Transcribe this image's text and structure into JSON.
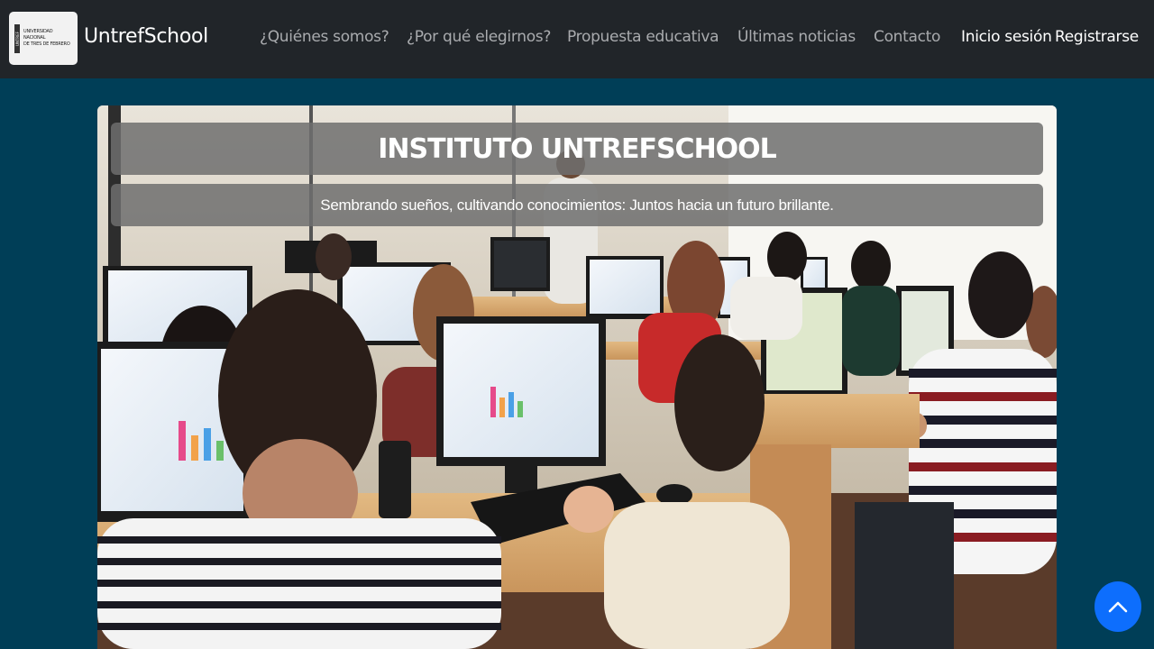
{
  "brand": {
    "logo_lines": [
      "UNIVERSIDAD",
      "NACIONAL",
      "DE TRES DE FEBRERO"
    ],
    "logo_vertical": "UNTREF",
    "name": "UntrefSchool"
  },
  "nav": {
    "items": [
      {
        "label": "¿Quiénes somos?"
      },
      {
        "label": "¿Por qué elegirnos?"
      },
      {
        "label": "Propuesta educativa"
      },
      {
        "label": "Últimas noticias"
      },
      {
        "label": "Contacto"
      }
    ],
    "login": "Inicio sesión",
    "register": "Registrarse"
  },
  "hero": {
    "title": "INSTITUTO UNTREFSCHOOL",
    "subtitle": "Sembrando sueños, cultivando conocimientos: Juntos hacia un futuro brillante.",
    "image_alt": "Students working at computers in a classroom"
  },
  "scroll_top": {
    "icon": "chevron-up-icon"
  },
  "colors": {
    "navbar_bg": "#212529",
    "page_bg": "#003e57",
    "accent": "#0d6efd"
  }
}
